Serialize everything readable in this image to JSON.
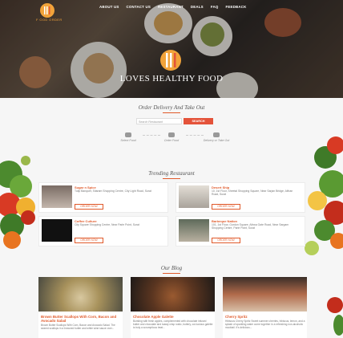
{
  "brand": {
    "logo_text": "F OOD ORDER"
  },
  "nav": [
    "ABOUT US",
    "CONTACT US",
    "RESTAURANT",
    "DEALS",
    "FAQ",
    "FEEDBACK"
  ],
  "hero": {
    "title": "LOVES HEALTHY FOOD"
  },
  "order": {
    "title": "Order Delivery And Take Out",
    "search_placeholder": "Search Restaurant",
    "search_button": "SEARCH",
    "steps": [
      "Select Food",
      "Order Food",
      "Delivery or Take Out"
    ]
  },
  "trending": {
    "title": "Trending Restaurant",
    "order_label": "ORDER NOW",
    "restaurants": [
      {
        "name": "Sugar n Spice",
        "address": "Tulip Banquet, Sitaram Shopping Centre, City Light Road, Surat"
      },
      {
        "name": "Desert Ship",
        "address": "10, 1st Floor, Sheetal Shopping Square, Near Sarjan Bridge, Althan Road, Surat"
      },
      {
        "name": "Coffee Culture",
        "address": "City Square Shopping Centre, Near Parle Point, Surat"
      },
      {
        "name": "Barbeque Nation",
        "address": "101, 1st Floor, Gordon Square, Athwa Gate Road, Near Sargam Shopping Centre, Parle Point, Surat"
      }
    ]
  },
  "blog": {
    "title": "Our Blog",
    "posts": [
      {
        "title": "Brown Butter Scallops With Corn, Bacon and Avocado Salad",
        "excerpt": "Brown Butter Scallops With Corn, Bacon and Avocado Salad. The seared scallops in a browned butter and white wine sauce over..."
      },
      {
        "title": "Chocolate Apple Galette",
        "excerpt": "Bursting with fresh apples, complemented with chocolate infused butter and chocolate and toasty crisp rustic, buttery, cut-lucious galette is truly a scrumptious treat..."
      },
      {
        "title": "Cherry Spritz",
        "excerpt": "Hibiscus Cherry Spritz Sweet summer cherries, hibiscus, lemon, and a splash of sparkling water come together in a refreshing non-alcoholic mocktail. It's delicious..."
      }
    ]
  },
  "colors": {
    "accent": "#e05a2b",
    "button": "#e4533a",
    "logo": "#f2a33a"
  }
}
